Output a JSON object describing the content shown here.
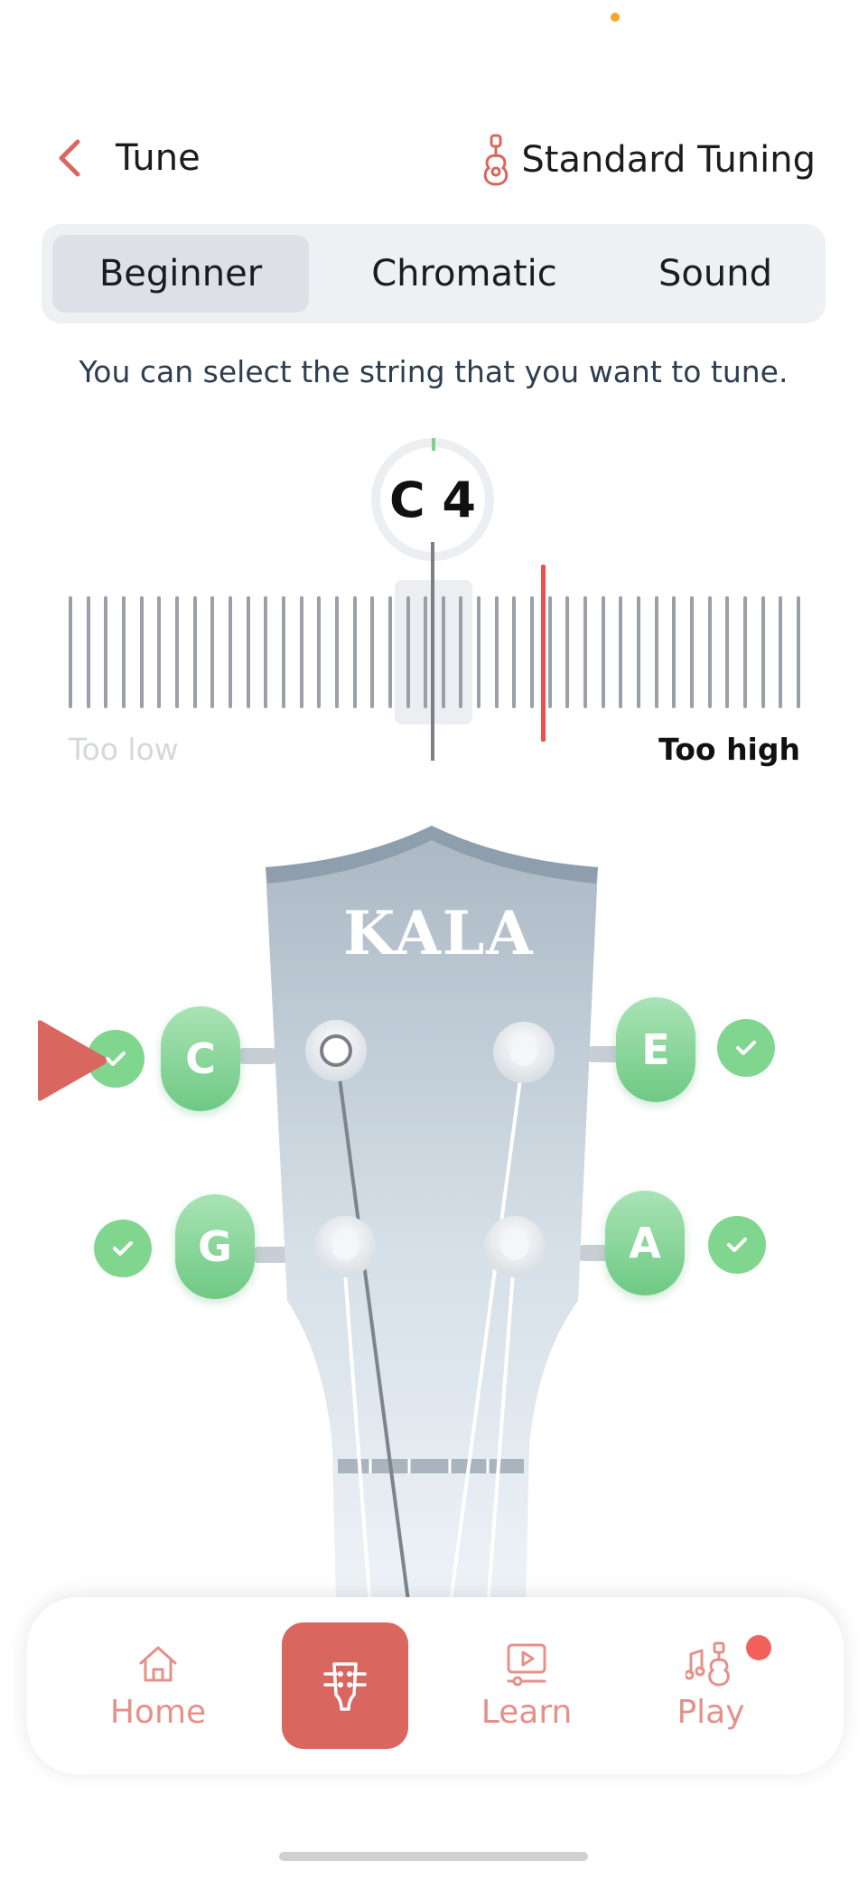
{
  "header": {
    "title": "Tune",
    "tuning_label": "Standard Tuning"
  },
  "segments": [
    {
      "label": "Beginner",
      "active": true
    },
    {
      "label": "Chromatic",
      "active": false
    },
    {
      "label": "Sound",
      "active": false
    }
  ],
  "hint": "You can select the string that you want to tune.",
  "tuner": {
    "note": "C 4",
    "too_low": "Too low",
    "too_high": "Too high"
  },
  "headstock": {
    "brand": "KALA",
    "pegs": [
      {
        "label": "C",
        "tuned": true
      },
      {
        "label": "E",
        "tuned": true
      },
      {
        "label": "G",
        "tuned": true
      },
      {
        "label": "A",
        "tuned": true
      }
    ]
  },
  "nav": {
    "home": "Home",
    "learn": "Learn",
    "play": "Play"
  },
  "colors": {
    "accent": "#d9665f",
    "tuned_green": "#6ec983",
    "needle_red": "#ec4f4f"
  }
}
